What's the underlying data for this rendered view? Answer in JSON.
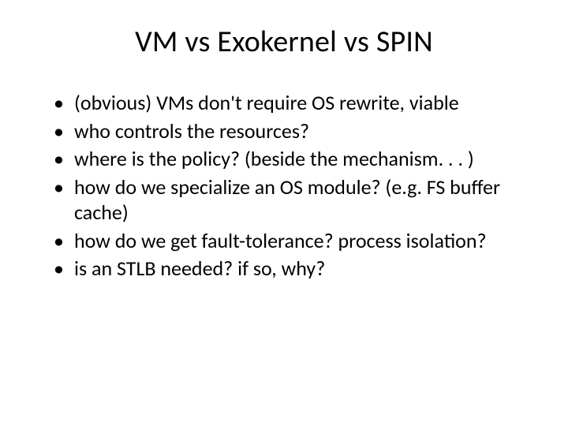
{
  "title": "VM vs Exokernel vs SPIN",
  "bullets": [
    "(obvious) VMs don't require OS rewrite, viable",
    "who controls the resources?",
    "where is the policy? (beside the mechanism. . . )",
    "how do we specialize an OS module? (e.g. FS buffer cache)",
    "how do we get fault-tolerance? process isolation?",
    "is an STLB needed? if so, why?"
  ]
}
